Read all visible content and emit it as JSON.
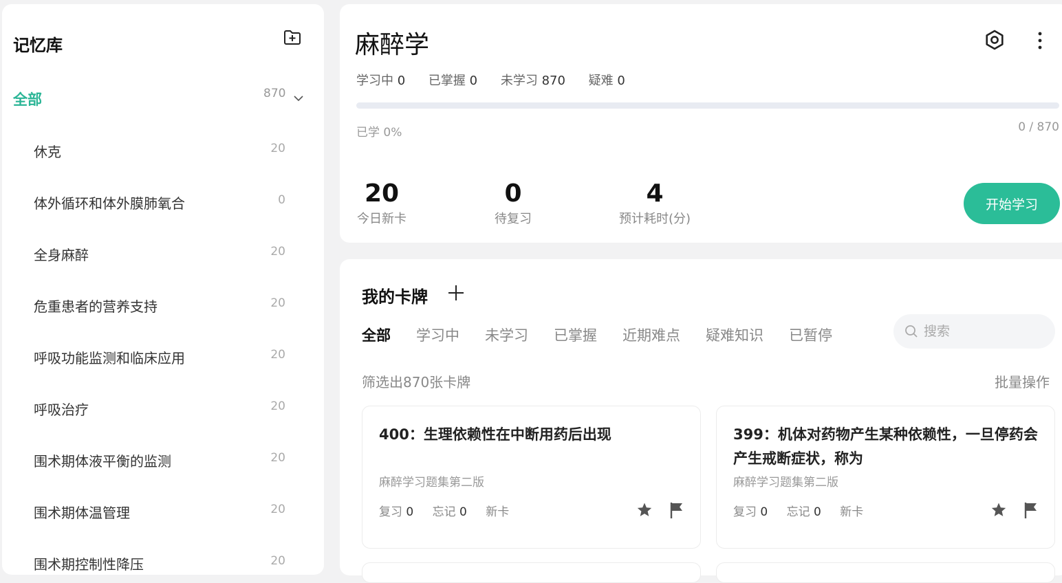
{
  "sidebar": {
    "title": "记忆库",
    "all_label": "全部",
    "all_count": "870",
    "items": [
      {
        "label": "休克",
        "count": "20"
      },
      {
        "label": "体外循环和体外膜肺氧合",
        "count": "0"
      },
      {
        "label": "全身麻醉",
        "count": "20"
      },
      {
        "label": "危重患者的营养支持",
        "count": "20"
      },
      {
        "label": "呼吸功能监测和临床应用",
        "count": "20"
      },
      {
        "label": "呼吸治疗",
        "count": "20"
      },
      {
        "label": "围术期体液平衡的监测",
        "count": "20"
      },
      {
        "label": "围术期体温管理",
        "count": "20"
      },
      {
        "label": "围术期控制性降压",
        "count": "20"
      }
    ]
  },
  "overview": {
    "title": "麻醉学",
    "stats": [
      {
        "label": "学习中",
        "value": "0"
      },
      {
        "label": "已掌握",
        "value": "0"
      },
      {
        "label": "未学习",
        "value": "870"
      },
      {
        "label": "疑难",
        "value": "0"
      }
    ],
    "progress_fraction": 0,
    "learned_text": "已学 0%",
    "ratio_text": "0 / 870",
    "metrics": [
      {
        "value": "20",
        "label": "今日新卡"
      },
      {
        "value": "0",
        "label": "待复习"
      },
      {
        "value": "4",
        "label": "预计耗时(分)"
      }
    ],
    "start_button": "开始学习"
  },
  "cards_section": {
    "title": "我的卡牌",
    "tabs": [
      "全部",
      "学习中",
      "未学习",
      "已掌握",
      "近期难点",
      "疑难知识",
      "已暂停"
    ],
    "active_tab": "全部",
    "search_placeholder": "搜索",
    "filter_info": "筛选出870张卡牌",
    "batch_label": "批量操作",
    "cards": [
      {
        "title": "400：生理依赖性在中断用药后出现",
        "source": "麻醉学习题集第二版",
        "review_label": "复习",
        "review_value": "0",
        "forget_label": "忘记",
        "forget_value": "0",
        "status": "新卡"
      },
      {
        "title": "399：机体对药物产生某种依赖性，一旦停药会产生戒断症状，称为",
        "source": "麻醉学习题集第二版",
        "review_label": "复习",
        "review_value": "0",
        "forget_label": "忘记",
        "forget_value": "0",
        "status": "新卡"
      }
    ]
  },
  "colors": {
    "accent": "#2bb596",
    "button": "#2bbd98",
    "progress_track": "#e8ebf2"
  },
  "icons": [
    "add-folder-icon",
    "chevron-down-icon",
    "eye-icon",
    "more-vertical-icon",
    "plus-icon",
    "search-icon",
    "star-icon",
    "flag-icon"
  ]
}
